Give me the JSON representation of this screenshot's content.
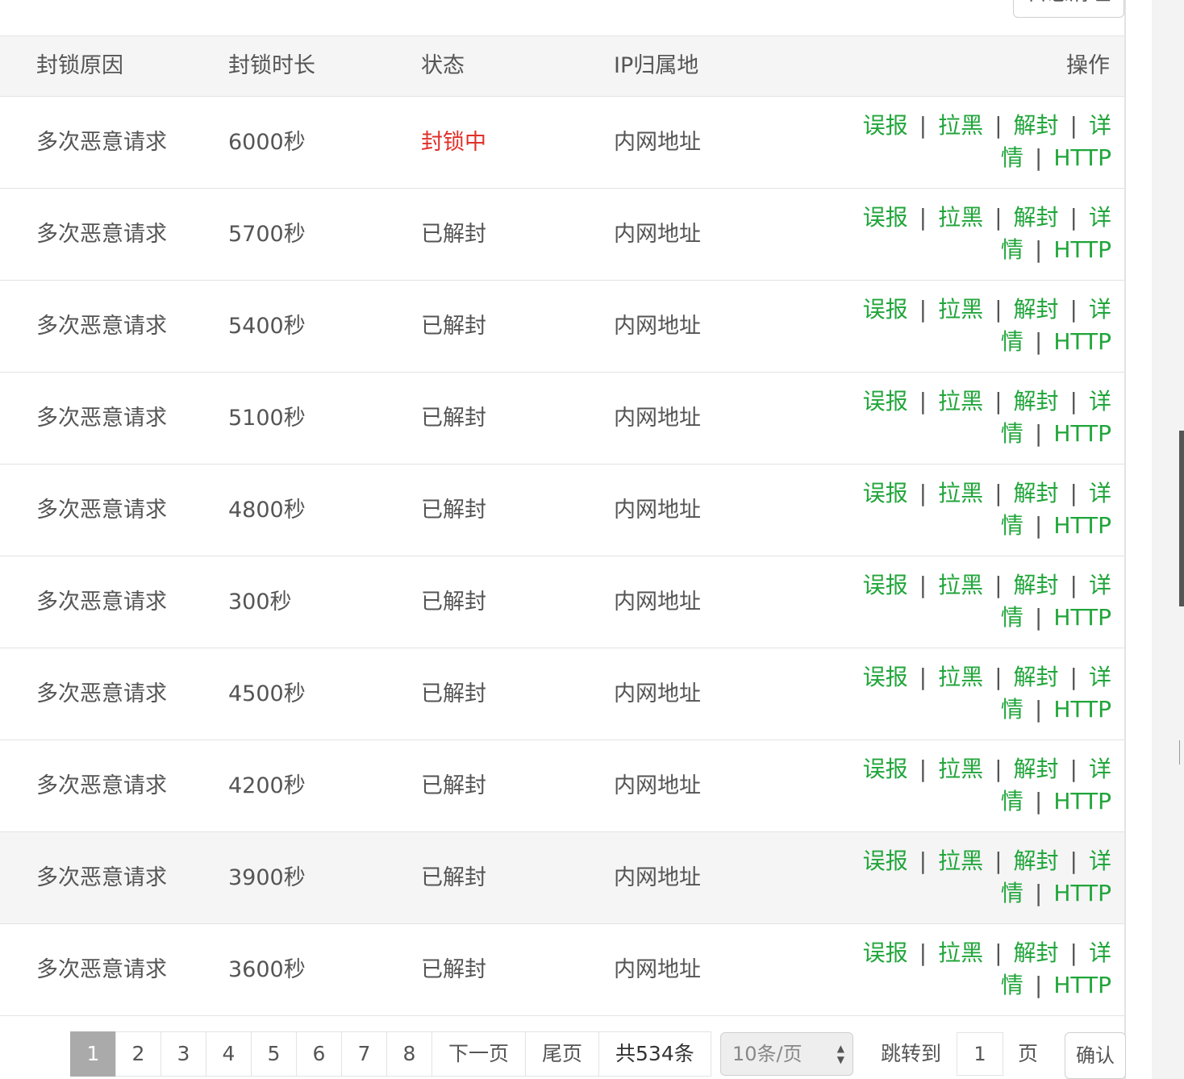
{
  "top_button": {
    "label": "日志清理"
  },
  "table": {
    "headers": [
      "封锁原因",
      "封锁时长",
      "状态",
      "IP归属地",
      "操作"
    ],
    "rows": [
      {
        "reason": "多次恶意请求",
        "duration": "6000秒",
        "status": "封锁中",
        "location": "内网地址"
      },
      {
        "reason": "多次恶意请求",
        "duration": "5700秒",
        "status": "已解封",
        "location": "内网地址"
      },
      {
        "reason": "多次恶意请求",
        "duration": "5400秒",
        "status": "已解封",
        "location": "内网地址"
      },
      {
        "reason": "多次恶意请求",
        "duration": "5100秒",
        "status": "已解封",
        "location": "内网地址"
      },
      {
        "reason": "多次恶意请求",
        "duration": "4800秒",
        "status": "已解封",
        "location": "内网地址"
      },
      {
        "reason": "多次恶意请求",
        "duration": "300秒",
        "status": "已解封",
        "location": "内网地址"
      },
      {
        "reason": "多次恶意请求",
        "duration": "4500秒",
        "status": "已解封",
        "location": "内网地址"
      },
      {
        "reason": "多次恶意请求",
        "duration": "4200秒",
        "status": "已解封",
        "location": "内网地址"
      },
      {
        "reason": "多次恶意请求",
        "duration": "3900秒",
        "status": "已解封",
        "location": "内网地址"
      },
      {
        "reason": "多次恶意请求",
        "duration": "3600秒",
        "status": "已解封",
        "location": "内网地址"
      }
    ],
    "actions": {
      "false_report": "误报",
      "blacklist": "拉黑",
      "unblock": "解封",
      "details": "详情",
      "http": "HTTP",
      "separator": "|"
    }
  },
  "pagination": {
    "pages": [
      "1",
      "2",
      "3",
      "4",
      "5",
      "6",
      "7",
      "8"
    ],
    "current": "1",
    "next": "下一页",
    "last": "尾页",
    "total": "共534条",
    "page_size": "10条/页",
    "jump_label": "跳转到",
    "jump_value": "1",
    "page_label": "页",
    "confirm": "确认"
  },
  "colors": {
    "link": "#20a53a",
    "blocked": "#e0312a",
    "text": "#555555"
  }
}
